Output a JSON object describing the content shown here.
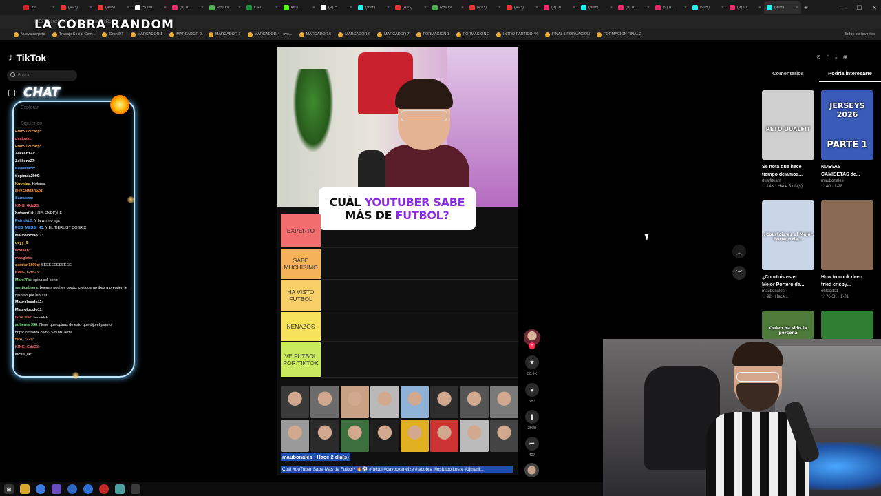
{
  "browser": {
    "tabs": [
      {
        "label": "39",
        "color": "#c62828"
      },
      {
        "label": "(493)",
        "color": "#e53935"
      },
      {
        "label": "(493)",
        "color": "#e53935"
      },
      {
        "label": "Sudo",
        "color": "#ffffff"
      },
      {
        "label": "(9) In",
        "color": "#e1306c"
      },
      {
        "label": "PRON",
        "color": "#4caf50"
      },
      {
        "label": "LA C",
        "color": "#1e8e3e"
      },
      {
        "label": "kick",
        "color": "#53fc18"
      },
      {
        "label": "(9) E",
        "color": "#ffffff"
      },
      {
        "label": "(99+)",
        "color": "#25f4ee"
      },
      {
        "label": "(493)",
        "color": "#e53935"
      },
      {
        "label": "PRON",
        "color": "#4caf50"
      },
      {
        "label": "(493)",
        "color": "#e53935"
      },
      {
        "label": "(493)",
        "color": "#e53935"
      },
      {
        "label": "(9) In",
        "color": "#e1306c"
      },
      {
        "label": "(99+)",
        "color": "#25f4ee"
      },
      {
        "label": "(9) In",
        "color": "#e1306c"
      },
      {
        "label": "(9) In",
        "color": "#e1306c"
      },
      {
        "label": "(99+)",
        "color": "#25f4ee"
      },
      {
        "label": "(9) In",
        "color": "#e1306c"
      },
      {
        "label": "(99+)",
        "color": "#25f4ee"
      }
    ],
    "url": "9952702262548?_r=1&_t=ZS-93n8xx2RcdV",
    "bookmarks": [
      "Nueva carpeta",
      "Trabajo Social Com...",
      "Gran DT",
      "MARCADOR 1",
      "MARCADOR 2",
      "MARCADOR 3",
      "MARCADOR 4 - ove...",
      "MARCADOR 5",
      "MARCADOR 6",
      "MARCADOR 7",
      "FORMACION 1",
      "FORMACION 2",
      "INTRO PARTIDO 4K",
      "FINAL 1 FORMACION",
      "FORMACION FINAL 2"
    ],
    "bookmarks_right": "Todos los favoritos"
  },
  "stream": {
    "title": "LA COBRA RANDOM",
    "chat_title": "CHAT"
  },
  "tiktok": {
    "logo": "TikTok",
    "search_placeholder": "Buscar",
    "faded_nav": [
      "Explorar",
      "Siguiendo"
    ],
    "chat": [
      {
        "user": "Fran9121carp",
        "text": ":",
        "color": "#ff9e40"
      },
      {
        "user": "dsaloski",
        "text": ":",
        "color": "#ff6b6b"
      },
      {
        "user": "Fran9121carp",
        "text": ":",
        "color": "#ff9e40"
      },
      {
        "user": "Zekkenz27",
        "text": ":",
        "color": "#ffffff"
      },
      {
        "user": "Zekkenz27",
        "text": ":",
        "color": "#ffffff"
      },
      {
        "user": "Kelvintaco",
        "text": ":",
        "color": "#4aa3ff"
      },
      {
        "user": "tiopixula2000",
        "text": ":",
        "color": "#ffffff"
      },
      {
        "user": "Kgoldas",
        "text": ": Hokaaa",
        "color": "#ffd54f"
      },
      {
        "user": "alexcapitan628",
        "text": ":",
        "color": "#ff9e40"
      },
      {
        "user": "Samusba",
        "text": ":",
        "color": "#4aa3ff"
      },
      {
        "user": "KING_Gdd23",
        "text": ":",
        "color": "#ff6b6b"
      },
      {
        "user": "hrdsant10",
        "text": ": LUIS ENRIQUE",
        "color": "#ffffff"
      },
      {
        "user": "PatrickL5",
        "text": ": Y la wnl no jaja",
        "color": "#4aa3ff"
      },
      {
        "user": "FCB_MESSI_45",
        "text": ": Y EL TIERLIST COBRIX",
        "color": "#4aa3ff"
      },
      {
        "user": "Maurolocolo11",
        "text": ":",
        "color": "#ffffff"
      },
      {
        "user": "deyy_9",
        "text": ":",
        "color": "#ffd54f"
      },
      {
        "user": "wixta16",
        "text": ":",
        "color": "#ff6b6b"
      },
      {
        "user": "masglato",
        "text": ":",
        "color": "#ff6b6b"
      },
      {
        "user": "damian1899q",
        "text": ": SEEEEEEEEEEE",
        "color": "#ff9e40"
      },
      {
        "user": "KING_Gdd23",
        "text": ":",
        "color": "#ff6b6b"
      },
      {
        "user": "Marc7Rx",
        "text": ": opina del cono",
        "color": "#7ee787"
      },
      {
        "user": "santicabrera",
        "text": ": buenas noches gordo, crei que no ibas a prender, te",
        "color": "#7ee787"
      },
      {
        "user": "",
        "text": "respeto por laburar",
        "color": "#ffffff"
      },
      {
        "user": "Maurolocolo11",
        "text": ":",
        "color": "#ffffff"
      },
      {
        "user": "Maurolocolo11",
        "text": ":",
        "color": "#ffffff"
      },
      {
        "user": "lyroCase",
        "text": ": SEEEEE",
        "color": "#ff6b6b"
      },
      {
        "user": "adhemar356",
        "text": ": Nene que opinas de esto que dijo el puerro",
        "color": "#7ee787"
      },
      {
        "user": "",
        "text": "https://vt.tiktok.com/ZSmuIBrTem/",
        "color": "#ffffff"
      },
      {
        "user": "tato_7725",
        "text": ":",
        "color": "#ff9e40"
      },
      {
        "user": "KING_Gdd23",
        "text": ":",
        "color": "#ff6b6b"
      },
      {
        "user": "aicell_sc",
        "text": ":",
        "color": "#ffffff"
      }
    ]
  },
  "video": {
    "question_part1": "CUÁL",
    "question_hl1": "YOUTUBER SABE",
    "question_part2": "MÁS DE",
    "question_hl2": "FUTBOL?",
    "tiers": [
      {
        "label": "EXPERTO",
        "color": "#f26d6d"
      },
      {
        "label": "SABE MUCHISIMO",
        "color": "#f5b25b"
      },
      {
        "label": "HA VISTO FUTBOL",
        "color": "#f7cf66"
      },
      {
        "label": "NENAZOS",
        "color": "#f7e35b"
      },
      {
        "label": "VE FUTBOL POR TIKTOK",
        "color": "#c8ea5c"
      }
    ],
    "author": "maubonales · Hace 2 día(s)",
    "description": "Cuál YouTuber Sabe Más de Futbol? 🔥⚽ #futbol #davooxeneize #lacobra #losfutbolitostv #djmaril..."
  },
  "actions": {
    "likes": "56.9K",
    "comments": "687",
    "saves": "2980",
    "shares": "407"
  },
  "right_panel": {
    "tabs": [
      "Comentarios",
      "Podría interesarte"
    ],
    "active_tab": "Podría interesarte",
    "cards": [
      {
        "thumb_text": "RETO DUALFIT",
        "title": "Se nota que hace",
        "title2": "tiempo dejamos...",
        "author": "dualfiteam",
        "stats": "♡ 14K · Hace 5 día(s)",
        "bg": "#cfcfcf"
      },
      {
        "thumb_text": "JERSEYS 2026",
        "thumb_text2": "PARTE 1",
        "title": "NUEVAS",
        "title2": "CAMISETAS de...",
        "author": "maubonales",
        "stats": "♡ 40 · 1-28",
        "bg": "#3b5bb8"
      },
      {
        "thumb_text": "¿Courtois es el Mejor Portero de...",
        "title": "¿Courtois es el",
        "title2": "Mejor Portero de...",
        "author": "maubonales",
        "stats": "♡ 92 · Hace...",
        "bg": "#c9d6e8"
      },
      {
        "thumb_text": "",
        "title": "How to cook deep",
        "title2": "fried crispy...",
        "author": "ohfood01",
        "stats": "♡ 76.6K · 1-21",
        "bg": "#8a6a52"
      },
      {
        "thumb_text": "Quien ha sido la persona",
        "title": "",
        "title2": "",
        "author": "",
        "stats": "",
        "bg": "#4e7a3a"
      },
      {
        "thumb_text": "",
        "title": "",
        "title2": "",
        "author": "",
        "stats": "",
        "bg": "#2e7d32"
      }
    ]
  }
}
